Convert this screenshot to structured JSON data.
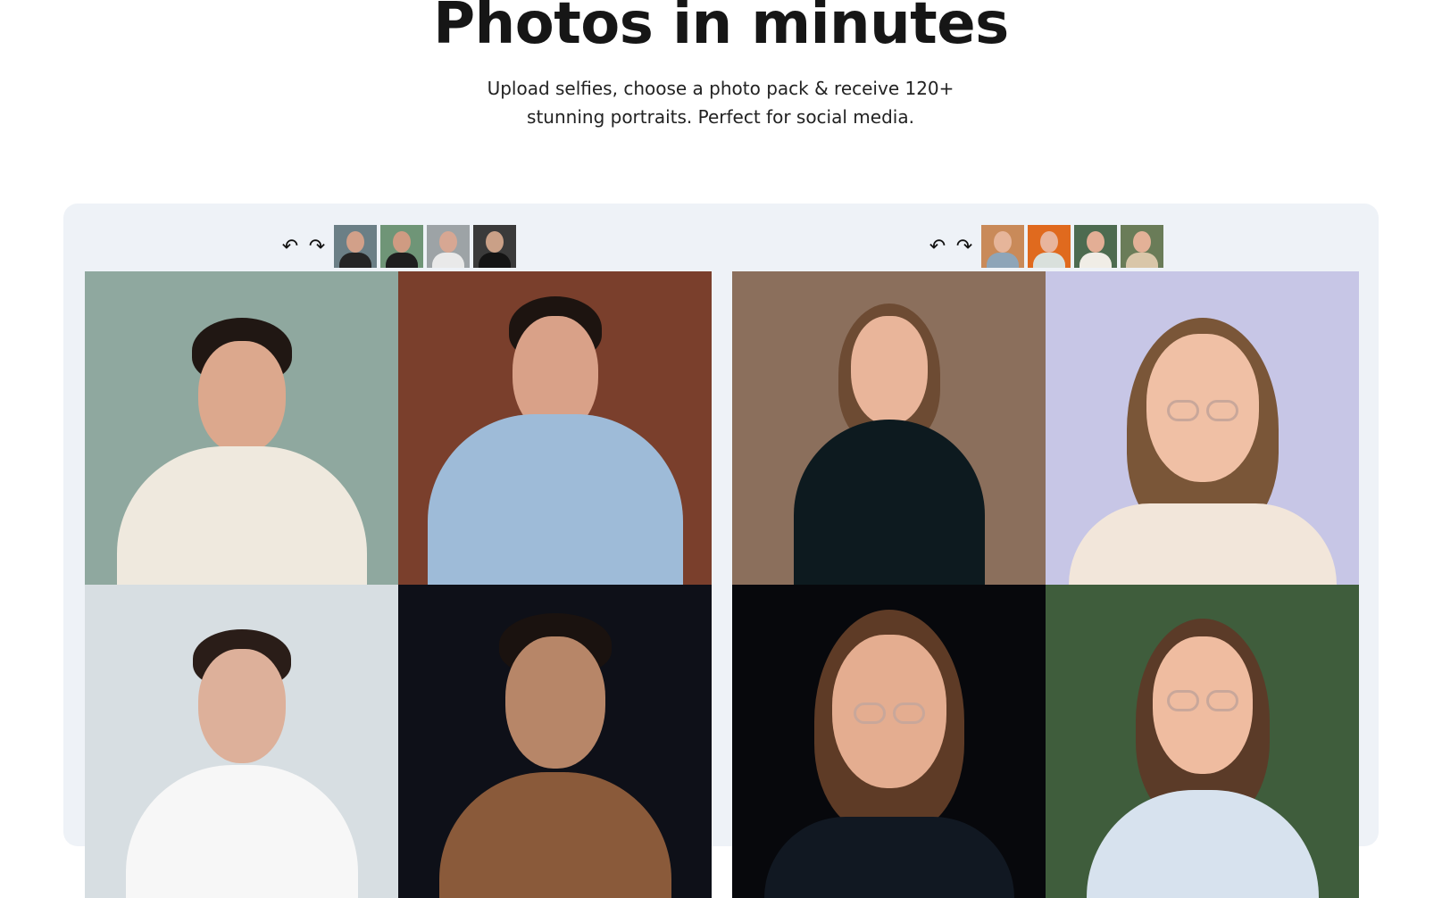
{
  "hero": {
    "title": "Photos in minutes",
    "subtitle": "Upload selfies, choose a photo pack & receive 120+ stunning portraits. Perfect for social media."
  },
  "packs": [
    {
      "id": "male",
      "arrows": [
        "↶",
        "↷"
      ],
      "selfies": [
        {
          "label": "selfie-1",
          "background": "#6b7f86",
          "face": "#d2a089",
          "clothes": "#252525"
        },
        {
          "label": "selfie-2",
          "background": "#6f9577",
          "face": "#cf9b82",
          "clothes": "#1e1e1e"
        },
        {
          "label": "selfie-3",
          "background": "#9da3a6",
          "face": "#d7a793",
          "clothes": "#e9e9e9"
        },
        {
          "label": "selfie-4",
          "background": "#3a3a3a",
          "face": "#caa087",
          "clothes": "#141414"
        }
      ],
      "portraits": [
        {
          "label": "portrait-1",
          "background": "#8fa89f",
          "hair": "#201713",
          "face": "#dca88d",
          "clothes": "#efe9de"
        },
        {
          "label": "portrait-2",
          "background": "#7a3f2c",
          "hair": "#1d1410",
          "face": "#d9a188",
          "clothes": "#9ebbd8"
        },
        {
          "label": "portrait-3",
          "background": "#d7dee2",
          "hair": "#2a1d18",
          "face": "#ddb09a",
          "clothes": "#f7f7f7"
        },
        {
          "label": "portrait-4",
          "background": "#0e1018",
          "hair": "#1a120f",
          "face": "#b78668",
          "clothes": "#8a5a3a"
        }
      ]
    },
    {
      "id": "female",
      "arrows": [
        "↶",
        "↷"
      ],
      "selfies": [
        {
          "label": "selfie-1",
          "background": "#c98a59",
          "face": "#e6b59a",
          "clothes": "#8ea5b8"
        },
        {
          "label": "selfie-2",
          "background": "#e06a1e",
          "face": "#e8b59d",
          "clothes": "#d9e0dc"
        },
        {
          "label": "selfie-3",
          "background": "#4d6b50",
          "face": "#e3ae95",
          "clothes": "#f0ede6"
        },
        {
          "label": "selfie-4",
          "background": "#6a7c58",
          "face": "#e3b197",
          "clothes": "#d9c6a9"
        }
      ],
      "portraits": [
        {
          "label": "portrait-1",
          "background": "#8b6f5c",
          "hair": "#6d4b33",
          "face": "#e9b59a",
          "clothes": "#0d1a1f"
        },
        {
          "label": "portrait-2",
          "background": "#c7c6e6",
          "hair": "#7a5638",
          "face": "#f0c0a5",
          "clothes": "#f2e6da"
        },
        {
          "label": "portrait-3",
          "background": "#07080c",
          "hair": "#5e3b26",
          "face": "#e4ad90",
          "clothes": "#111822"
        },
        {
          "label": "portrait-4",
          "background": "#3f5d3c",
          "hair": "#5b3b28",
          "face": "#efbca0",
          "clothes": "#d7e2ee"
        }
      ]
    }
  ],
  "colors": {
    "panel_background": "#eef2f7",
    "title_text": "#161616",
    "subtitle_text": "#222222"
  }
}
